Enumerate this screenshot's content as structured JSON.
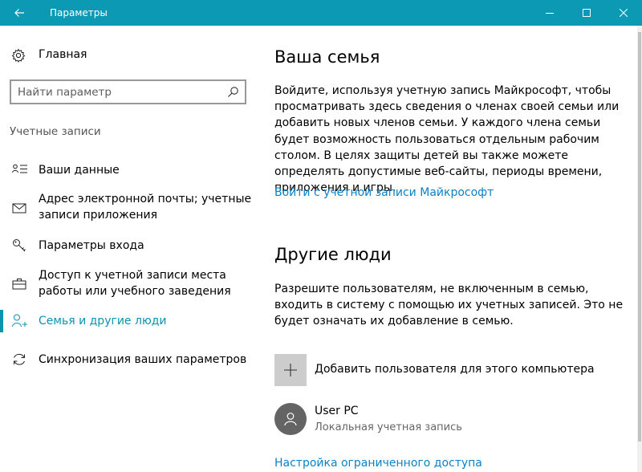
{
  "window": {
    "title": "Параметры",
    "accent": "#0c99b4"
  },
  "sidebar": {
    "home_label": "Главная",
    "search_placeholder": "Найти параметр",
    "section_title": "Учетные записи",
    "items": [
      {
        "label": "Ваши данные",
        "icon": "person-card-icon"
      },
      {
        "label": "Адрес электронной почты; учетные записи приложения",
        "icon": "mail-icon"
      },
      {
        "label": "Параметры входа",
        "icon": "key-icon"
      },
      {
        "label": "Доступ к учетной записи места работы или учебного заведения",
        "icon": "briefcase-icon"
      },
      {
        "label": "Семья и другие люди",
        "icon": "person-add-icon",
        "active": true
      },
      {
        "label": "Синхронизация ваших параметров",
        "icon": "sync-icon"
      }
    ]
  },
  "main": {
    "family": {
      "title": "Ваша семья",
      "text": "Войдите, используя учетную запись Майкрософт, чтобы просматривать здесь сведения о членах своей семьи или добавить новых членов семьи. У каждого члена семьи будет возможность пользоваться отдельным рабочим столом. В целях защиты детей вы также можете определять допустимые веб-сайты, периоды времени, приложения и игры.",
      "link": "Войти с учетной записи Майкрософт"
    },
    "others": {
      "title": "Другие люди",
      "text": "Разрешите пользователям, не включенным в семью, входить в систему с помощью их учетных записей. Это не будет означать их добавление в семью.",
      "add_label": "Добавить пользователя для этого компьютера",
      "user": {
        "name": "User PC",
        "type": "Локальная учетная запись"
      },
      "restricted_link": "Настройка ограниченного доступа"
    }
  }
}
